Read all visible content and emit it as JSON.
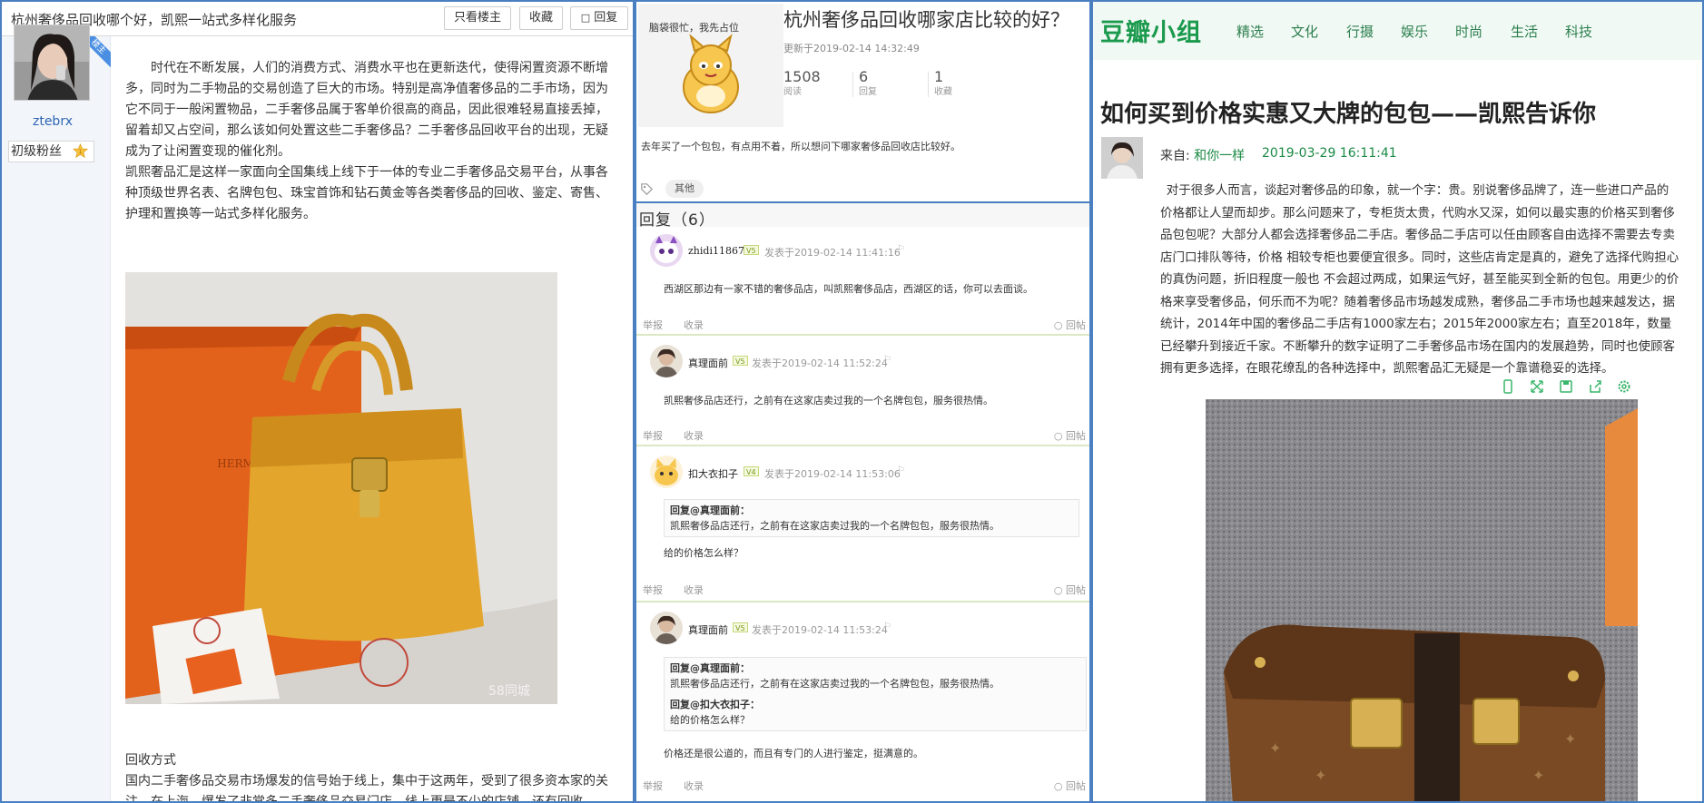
{
  "left": {
    "topbar": {
      "title": "杭州奢侈品回收哪个好，凯熙一站式多样化服务",
      "only_op": "只看楼主",
      "favorite": "收藏",
      "reply": "回复"
    },
    "author": {
      "name": "ztebrx",
      "rank": "初级粉丝",
      "badge": "楼主"
    },
    "paragraphs": [
      "时代在不断发展，人们的消费方式、消费水平也在更新迭代，使得闲置资源不断增多，同时为二手物品的交易创造了巨大的市场。特别是高净值奢侈品的二手市场，因为它不同于一般闲置物品，二手奢侈品属于客单价很高的商品，因此很难轻易直接丢掉，留着却又占空间，那么该如何处置这些二手奢侈品？二手奢侈品回收平台的出现，无疑成为了让闲置变现的催化剂。",
      "凯熙奢品汇是这样一家面向全国集线上线下于一体的专业二手奢侈品交易平台，从事各种顶级世界名表、名牌包包、珠宝首饰和钻石黄金等各类奢侈品的回收、鉴定、寄售、护理和置换等一站式多样化服务。"
    ],
    "photo_watermark": "58同城",
    "section_title": "回收方式",
    "section_body": "国内二手奢侈品交易市场爆发的信号始于线上，集中于这两年，受到了很多资本家的关注。在上海，爆发了非常多二手奢侈品交易门店，线上更是不少的店铺，还有回收"
  },
  "middle": {
    "image_caption": "脑袋很忙，我先占位",
    "title": "杭州奢侈品回收哪家店比较的好？",
    "updated": "更新于2019-02-14 14:32:49",
    "stats": [
      {
        "num": "1508",
        "label": "阅读"
      },
      {
        "num": "6",
        "label": "回复"
      },
      {
        "num": "1",
        "label": "收藏"
      }
    ],
    "description": "去年买了一个包包，有点用不着，所以想问下哪家奢侈品回收店比较好。",
    "tag": "其他",
    "reply_header": "回复（6）",
    "actions": {
      "report": "举报",
      "collect": "收录",
      "reply": "回帖"
    },
    "replies": [
      {
        "name": "zhidi11867",
        "level": "V5",
        "time": "发表于2019-02-14 11:41:16",
        "text": "西湖区那边有一家不错的奢侈品店，叫凯熙奢侈品店，西湖区的话，你可以去面谈。"
      },
      {
        "name": "真理面前",
        "level": "V5",
        "time": "发表于2019-02-14 11:52:24",
        "text": "凯熙奢侈品店还行，之前有在这家店卖过我的一个名牌包包，服务很热情。"
      },
      {
        "name": "扣大衣扣子",
        "level": "V4",
        "time": "发表于2019-02-14 11:53:06",
        "quotes": [
          {
            "head": "回复@真理面前：",
            "body": "凯熙奢侈品店还行，之前有在这家店卖过我的一个名牌包包，服务很热情。"
          }
        ],
        "text": "给的价格怎么样？"
      },
      {
        "name": "真理面前",
        "level": "V5",
        "time": "发表于2019-02-14 11:53:24",
        "quotes": [
          {
            "head": "回复@真理面前：",
            "body": "凯熙奢侈品店还行，之前有在这家店卖过我的一个名牌包包，服务很热情。"
          },
          {
            "head": "回复@扣大衣扣子：",
            "body": "给的价格怎么样？"
          }
        ],
        "text": "价格还是很公道的，而且有专门的人进行鉴定，挺满意的。"
      }
    ]
  },
  "right": {
    "logo": "豆瓣小组",
    "nav": [
      "精选",
      "文化",
      "行摄",
      "娱乐",
      "时尚",
      "生活",
      "科技"
    ],
    "title": "如何买到价格实惠又大牌的包包——凯熙告诉你",
    "from_label": "来自: ",
    "from_name": "和你一样",
    "date": "2019-03-29 16:11:41",
    "body": "对于很多人而言，谈起对奢侈品的印象，就一个字：贵。别说奢侈品牌了，连一些进口产品的价格都让人望而却步。那么问题来了，专柜货太贵，代购水又深，如何以最实惠的价格买到奢侈品包包呢？大部分人都会选择奢侈品二手店。奢侈品二手店可以任由顾客自由选择不需要去专卖店门口排队等待，价格 相较专柜也要便宜很多。同时，这些店肯定是真的，避免了选择代购担心的真伪问题，折旧程度一般也 不会超过两成，如果运气好，甚至能买到全新的包包。用更少的价格来享受奢侈品，何乐而不为呢？随着奢侈品市场越发成熟，奢侈品二手市场也越来越发达，据统计，2014年中国的奢侈品二手店有1000家左右；2015年2000家左右；直至2018年，数量已经攀升到接近千家。不断攀升的数字证明了二手奢侈品市场在国内的发展趋势，同时也使顾客拥有更多选择，在眼花缭乱的各种选择中，凯熙奢品汇无疑是一个靠谱稳妥的选择。"
  },
  "colors": {
    "panel_border": "#4a7fc1",
    "douban_green": "#1b9a4d",
    "link_blue": "#2d64b3"
  }
}
